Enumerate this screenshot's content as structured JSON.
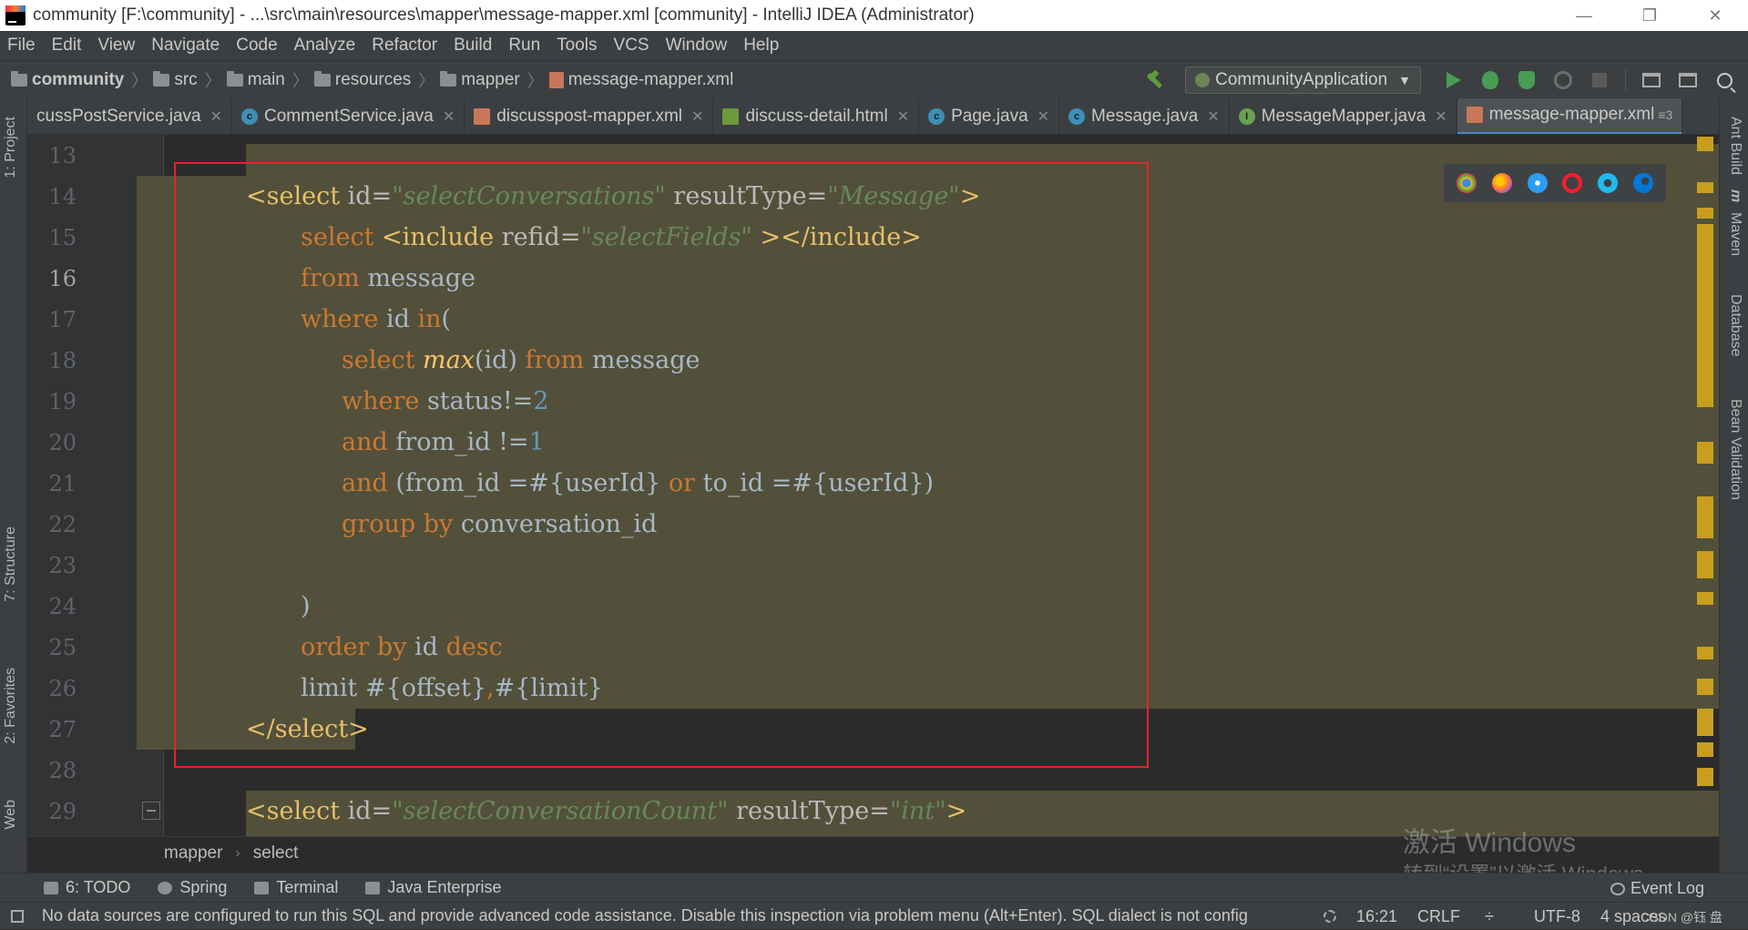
{
  "window": {
    "title": "community [F:\\community] - ...\\src\\main\\resources\\mapper\\message-mapper.xml [community] - IntelliJ IDEA (Administrator)",
    "controls": {
      "minimize": "—",
      "restore": "❐",
      "close": "✕"
    }
  },
  "menu": [
    "File",
    "Edit",
    "View",
    "Navigate",
    "Code",
    "Analyze",
    "Refactor",
    "Build",
    "Run",
    "Tools",
    "VCS",
    "Window",
    "Help"
  ],
  "breadcrumbs": [
    {
      "label": "community",
      "icon": "folder-icon",
      "bold": true
    },
    {
      "label": "src",
      "icon": "folder-icon"
    },
    {
      "label": "main",
      "icon": "folder-icon"
    },
    {
      "label": "resources",
      "icon": "folder-icon"
    },
    {
      "label": "mapper",
      "icon": "folder-icon"
    },
    {
      "label": "message-mapper.xml",
      "icon": "xml-file-icon"
    }
  ],
  "run_config": {
    "label": "CommunityApplication",
    "chevron": "▼"
  },
  "tabs": [
    {
      "label": "cussPostService.java",
      "icon": "none"
    },
    {
      "label": "CommentService.java",
      "icon": "class"
    },
    {
      "label": "discusspost-mapper.xml",
      "icon": "xml"
    },
    {
      "label": "discuss-detail.html",
      "icon": "html"
    },
    {
      "label": "Page.java",
      "icon": "class"
    },
    {
      "label": "Message.java",
      "icon": "class"
    },
    {
      "label": "MessageMapper.java",
      "icon": "iface"
    },
    {
      "label": "message-mapper.xml",
      "icon": "xml",
      "active": true
    }
  ],
  "tab_close": "✕",
  "tab_more": "≡3",
  "left_tools": {
    "project": "1: Project",
    "structure": "7: Structure",
    "favorites": "2: Favorites",
    "web": "Web"
  },
  "right_tools": {
    "ant": "Ant Build",
    "maven": "Maven",
    "database": "Database",
    "bean": "Bean Validation"
  },
  "maven_glyph": "m",
  "gutter_lines": [
    "13",
    "14",
    "15",
    "16",
    "17",
    "18",
    "19",
    "20",
    "21",
    "22",
    "23",
    "24",
    "25",
    "26",
    "27",
    "28",
    "29"
  ],
  "code": {
    "l14": {
      "open": "<select ",
      "a1": "id=",
      "v1": "\"selectConversations\"",
      "a2": " resultType=",
      "v2": "\"Message\"",
      "close": ">"
    },
    "l15": {
      "kw": "select ",
      "tag": "<include ",
      "a1": "refid=",
      "v1": "\"selectFields\"",
      "sp": " ",
      "tag2": "></include>"
    },
    "l16": {
      "kw": "from ",
      "txt": "message"
    },
    "l17": {
      "kw": "where ",
      "txt": "id ",
      "kw2": "in",
      "txt2": "("
    },
    "l18": {
      "kw": "select ",
      "fn": "max",
      "txt": "(id) ",
      "kw2": "from ",
      "txt2": "message"
    },
    "l19": {
      "kw": "where ",
      "txt": "status!=",
      "num": "2"
    },
    "l20": {
      "kw": "and ",
      "txt": "from_id !=",
      "num": "1"
    },
    "l21": {
      "kw": "and ",
      "txt": "(from_id =#{userId} ",
      "kw2": "or ",
      "txt2": "to_id =#{userId})"
    },
    "l22": {
      "kw": "group by ",
      "txt": "conversation_id"
    },
    "l24": {
      "txt": ")"
    },
    "l25": {
      "kw": "order by ",
      "txt": "id ",
      "kw2": "desc"
    },
    "l26": {
      "txt": "limit #{offset}",
      "kw": ",",
      "txt2": "#{limit}"
    },
    "l27": {
      "tag": "</select>"
    },
    "l29": {
      "open": "<select ",
      "a1": "id=",
      "v1": "\"selectConversationCount\"",
      "a2": " resultType=",
      "v2": "\"int\"",
      "close": ">"
    }
  },
  "editor_breadcrumb": [
    "mapper",
    "select"
  ],
  "breadcrumb_sep": "›",
  "watermark": {
    "line1": "激活 Windows",
    "line2": "转到“设置”以激活 Windows。"
  },
  "tool_windows": [
    "6: TODO",
    "Spring",
    "Terminal",
    "Java Enterprise"
  ],
  "event_log": "Event Log",
  "status": {
    "message": "No data sources are configured to run this SQL and provide advanced code assistance. Disable this inspection via problem menu (Alt+Enter). SQL dialect is not config",
    "position": "16:21",
    "line_sep": "CRLF",
    "line_sep_arrow": "÷",
    "encoding": "UTF-8",
    "indent": "4 spaces",
    "csdn": "CSDN @钰 盘"
  },
  "colors": {
    "accent": "#4a88c7",
    "highlight": "#52503a",
    "red_box": "#e0262d",
    "scroll_marker": "#c99e1e"
  }
}
